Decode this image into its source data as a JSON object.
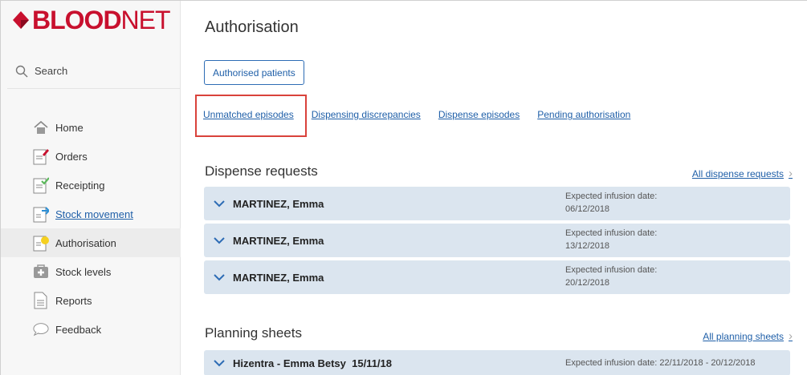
{
  "brand": {
    "blood": "BLOOD",
    "net": "NET",
    "color": "#c8102e"
  },
  "sidebar": {
    "search_label": "Search",
    "items": [
      {
        "label": "Home",
        "icon": "home-icon",
        "active": false,
        "link": false
      },
      {
        "label": "Orders",
        "icon": "orders-icon",
        "active": false,
        "link": false
      },
      {
        "label": "Receipting",
        "icon": "receipting-icon",
        "active": false,
        "link": false
      },
      {
        "label": "Stock movement",
        "icon": "stock-movement-icon",
        "active": false,
        "link": true
      },
      {
        "label": "Authorisation",
        "icon": "authorisation-icon",
        "active": true,
        "link": false
      },
      {
        "label": "Stock levels",
        "icon": "stock-levels-icon",
        "active": false,
        "link": false
      },
      {
        "label": "Reports",
        "icon": "reports-icon",
        "active": false,
        "link": false
      },
      {
        "label": "Feedback",
        "icon": "feedback-icon",
        "active": false,
        "link": false
      }
    ]
  },
  "main": {
    "title": "Authorisation",
    "authorised_button": "Authorised patients",
    "tabs": [
      "Unmatched episodes",
      "Dispensing discrepancies",
      "Dispense episodes",
      "Pending authorisation"
    ],
    "dispense_requests": {
      "title": "Dispense requests",
      "all_link": "All dispense requests",
      "rows": [
        {
          "name": "MARTINEZ, Emma",
          "date_label": "Expected infusion date:",
          "date": "06/12/2018"
        },
        {
          "name": "MARTINEZ, Emma",
          "date_label": "Expected infusion date:",
          "date": "13/12/2018"
        },
        {
          "name": "MARTINEZ, Emma",
          "date_label": "Expected infusion date:",
          "date": "20/12/2018"
        }
      ]
    },
    "planning_sheets": {
      "title": "Planning sheets",
      "all_link": "All planning sheets",
      "rows": [
        {
          "name": "Hizentra - Emma Betsy  15/11/18",
          "date": "Expected infusion date: 22/11/2018 - 20/12/2018"
        }
      ]
    }
  },
  "colors": {
    "accent": "#1f5fa8",
    "card_bg": "#dbe5ef",
    "highlight": "#d9423b"
  }
}
